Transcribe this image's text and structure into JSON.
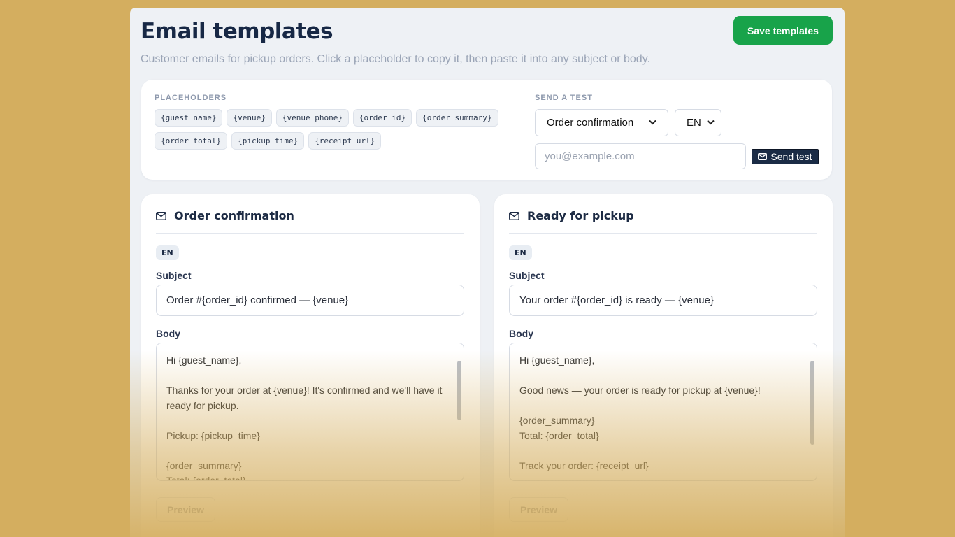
{
  "header": {
    "title": "Email templates",
    "subtitle": "Customer emails for pickup orders. Click a placeholder to copy it, then paste it into any subject or body.",
    "save_label": "Save templates"
  },
  "placeholders": {
    "label": "PLACEHOLDERS",
    "items": [
      "{guest_name}",
      "{venue}",
      "{venue_phone}",
      "{order_id}",
      "{order_summary}",
      "{order_total}",
      "{pickup_time}",
      "{receipt_url}"
    ]
  },
  "send_test": {
    "label": "SEND A TEST",
    "template_selected": "Order confirmation",
    "language_selected": "EN",
    "email_placeholder": "you@example.com",
    "button_label": "Send test"
  },
  "templates": [
    {
      "icon": "mail-icon",
      "title": "Order confirmation",
      "language": "EN",
      "subject_label": "Subject",
      "subject": "Order #{order_id} confirmed — {venue}",
      "body_label": "Body",
      "body": "Hi {guest_name},\n\nThanks for your order at {venue}! It's confirmed and we'll have it ready for pickup.\n\nPickup: {pickup_time}\n\n{order_summary}\nTotal: {order_total}",
      "preview_label": "Preview"
    },
    {
      "icon": "mail-icon",
      "title": "Ready for pickup",
      "language": "EN",
      "subject_label": "Subject",
      "subject": "Your order #{order_id} is ready — {venue}",
      "body_label": "Body",
      "body": "Hi {guest_name},\n\nGood news — your order is ready for pickup at {venue}!\n\n{order_summary}\nTotal: {order_total}\n\nTrack your order: {receipt_url}",
      "preview_label": "Preview"
    }
  ],
  "colors": {
    "background": "#d4ae5f",
    "panel": "#eef1f5",
    "save_button": "#18a34a",
    "send_button": "#1a2b45",
    "title_text": "#172845"
  }
}
